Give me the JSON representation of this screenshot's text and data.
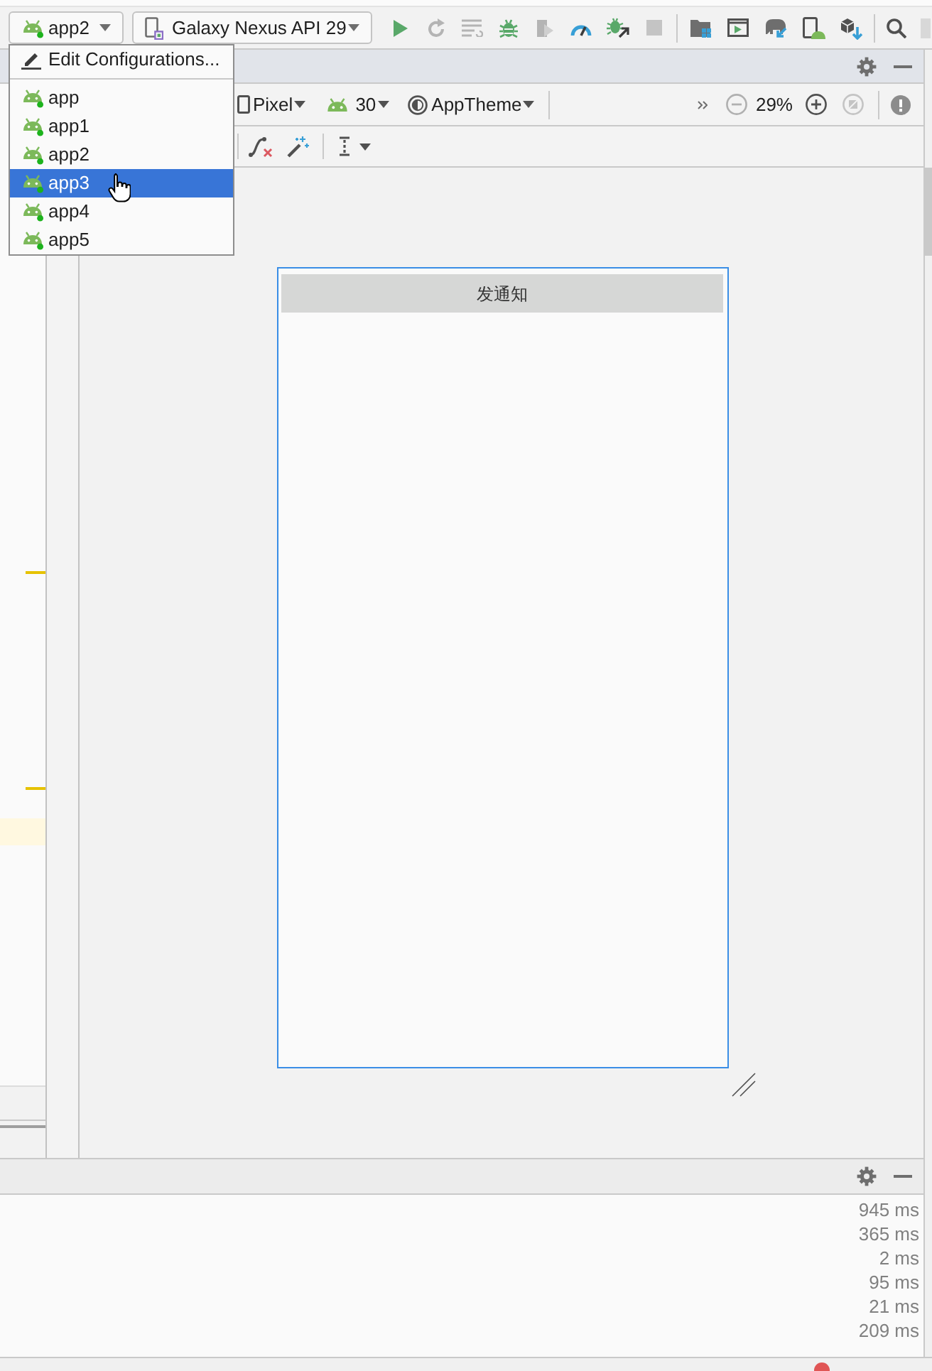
{
  "toolbar": {
    "run_configuration": "app2",
    "device": "Galaxy Nexus API 29"
  },
  "run_configuration_menu": {
    "edit_item": "Edit Configurations...",
    "items": [
      {
        "label": "app",
        "selected": false
      },
      {
        "label": "app1",
        "selected": false
      },
      {
        "label": "app2",
        "selected": false
      },
      {
        "label": "app3",
        "selected": true
      },
      {
        "label": "app4",
        "selected": false
      },
      {
        "label": "app5",
        "selected": false
      }
    ]
  },
  "design_toolbar": {
    "device": "Pixel",
    "api_level": "30",
    "theme": "AppTheme",
    "zoom": "29%"
  },
  "preview": {
    "button": "发通知"
  },
  "bottom_panel": {
    "durations": [
      "945 ms",
      "365 ms",
      "2 ms",
      "95 ms",
      "21 ms",
      "209 ms"
    ]
  }
}
